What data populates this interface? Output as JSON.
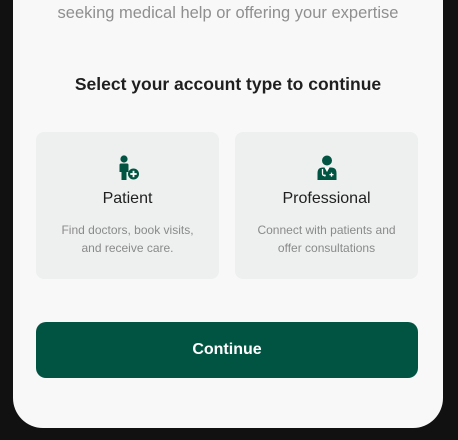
{
  "header": {
    "subtitle": "seeking medical help or offering your expertise"
  },
  "prompt": {
    "heading": "Select your account type to continue"
  },
  "account_types": [
    {
      "title": "Patient",
      "description": "Find doctors, book visits, and receive care.",
      "icon": "person-add-icon"
    },
    {
      "title": "Professional",
      "description": "Connect with patients and offer consultations",
      "icon": "doctor-icon"
    }
  ],
  "actions": {
    "continue_label": "Continue"
  },
  "colors": {
    "accent": "#015441",
    "card_background": "#edf0ef",
    "screen_background": "#f8f8f8",
    "device_frame": "#111111"
  }
}
